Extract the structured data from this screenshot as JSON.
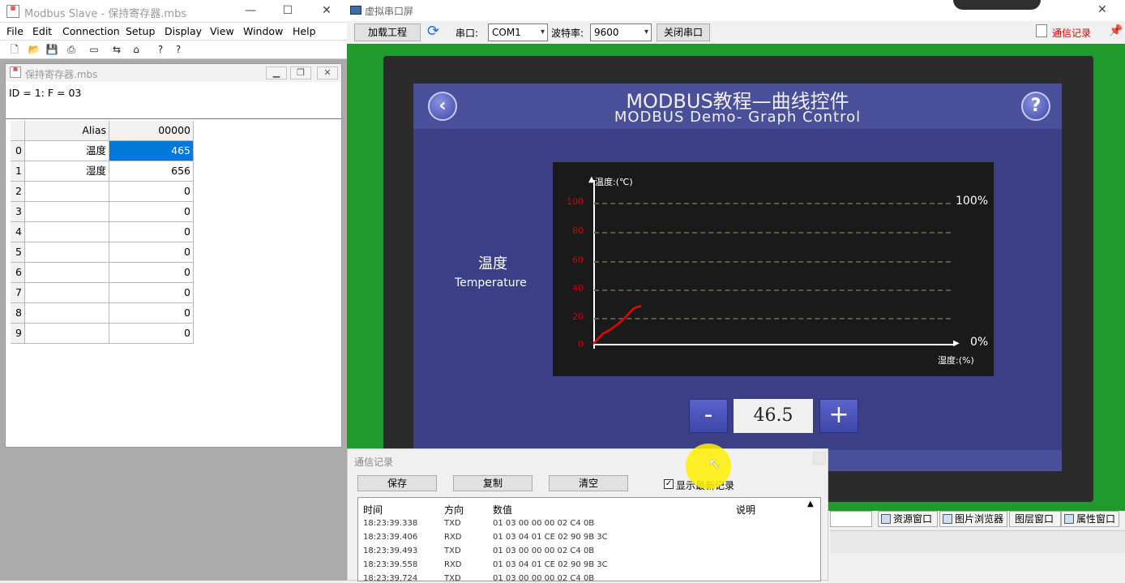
{
  "modbus_slave": {
    "title": "Modbus Slave - 保持寄存器.mbs",
    "menu": [
      "File",
      "Edit",
      "Connection",
      "Setup",
      "Display",
      "View",
      "Window",
      "Help"
    ],
    "child_title": "保持寄存器.mbs",
    "id_line": "ID = 1: F = 03",
    "grid": {
      "col_alias": "Alias",
      "col_addr": "00000",
      "rows": [
        {
          "idx": "0",
          "alias": "温度",
          "value": "465"
        },
        {
          "idx": "1",
          "alias": "湿度",
          "value": "656"
        },
        {
          "idx": "2",
          "alias": "",
          "value": "0"
        },
        {
          "idx": "3",
          "alias": "",
          "value": "0"
        },
        {
          "idx": "4",
          "alias": "",
          "value": "0"
        },
        {
          "idx": "5",
          "alias": "",
          "value": "0"
        },
        {
          "idx": "6",
          "alias": "",
          "value": "0"
        },
        {
          "idx": "7",
          "alias": "",
          "value": "0"
        },
        {
          "idx": "8",
          "alias": "",
          "value": "0"
        },
        {
          "idx": "9",
          "alias": "",
          "value": "0"
        }
      ]
    }
  },
  "vscreen": {
    "title": "虚拟串口屏",
    "load_btn": "加载工程",
    "port_label": "串口:",
    "port_value": "COM1",
    "baud_label": "波特率:",
    "baud_value": "9600",
    "close_btn": "关闭串口",
    "log_link": "通信记录",
    "hmi": {
      "title_cn": "MODBUS教程—曲线控件",
      "title_en": "MODBUS Demo- Graph Control",
      "back_icon": "‹",
      "help_icon": "?",
      "label_cn": "温度",
      "label_en": "Temperature",
      "y_axis_label": "温度:(℃)",
      "x_axis_label": "湿度:(%)",
      "right_top": "100%",
      "right_bottom": "0%",
      "y_ticks": [
        "100",
        "80",
        "60",
        "40",
        "20",
        "0"
      ],
      "minus": "-",
      "plus": "+",
      "value": "46.5"
    },
    "dock_tabs": [
      "资源窗口",
      "图片浏览器",
      "图层窗口",
      "属性窗口"
    ]
  },
  "comm_log": {
    "title": "通信记录",
    "save": "保存",
    "copy": "复制",
    "clear": "清空",
    "show_latest": "显示最新记录",
    "cols": [
      "时间",
      "方向",
      "数值",
      "说明"
    ],
    "rows": [
      {
        "time": "18:23:39.338",
        "dir": "TXD",
        "data": "01 03 00 00 00 02 C4 0B"
      },
      {
        "time": "18:23:39.406",
        "dir": "RXD",
        "data": "01 03 04 01 CE 02 90 9B 3C"
      },
      {
        "time": "18:23:39.493",
        "dir": "TXD",
        "data": "01 03 00 00 00 02 C4 0B"
      },
      {
        "time": "18:23:39.558",
        "dir": "RXD",
        "data": "01 03 04 01 CE 02 90 9B 3C"
      },
      {
        "time": "18:23:39.724",
        "dir": "TXD",
        "data": "01 03 00 00 00 02 C4 0B"
      }
    ]
  },
  "chart_data": {
    "type": "line",
    "ylabel": "温度:(℃)",
    "xlabel": "湿度:(%)",
    "ylim": [
      0,
      100
    ],
    "y": [
      0,
      7,
      10,
      14,
      19,
      25,
      27
    ]
  }
}
